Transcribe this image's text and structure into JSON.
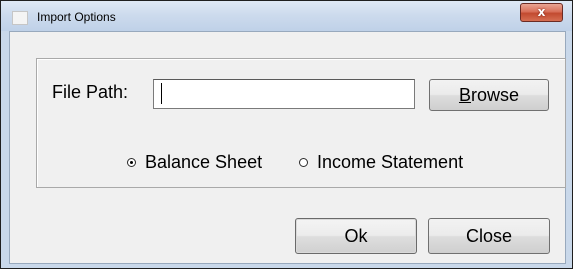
{
  "window": {
    "title": "Import Options",
    "close_glyph": "x",
    "app_icon": "window-icon"
  },
  "form": {
    "file_path_label": "File Path:",
    "file_path_value": "",
    "browse": {
      "mnemonic": "B",
      "rest": "rowse"
    },
    "statement_type": {
      "options": [
        {
          "label": "Balance Sheet",
          "selected": true
        },
        {
          "label": "Income Statement",
          "selected": false
        }
      ]
    }
  },
  "buttons": {
    "ok_label": "Ok",
    "close_label": "Close"
  }
}
